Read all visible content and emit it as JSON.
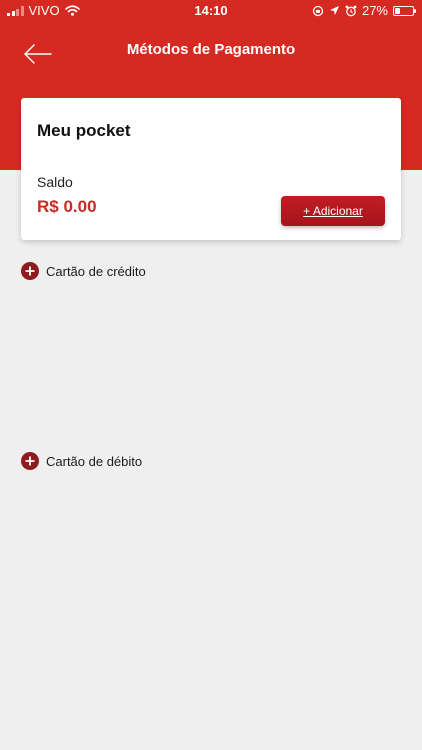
{
  "status_bar": {
    "carrier": "VIVO",
    "time": "14:10",
    "battery_text": "27%",
    "battery_level": 0.27,
    "icons": [
      "signal-icon",
      "wifi-icon",
      "rotation-lock-icon",
      "location-icon",
      "alarm-icon",
      "battery-icon"
    ]
  },
  "header": {
    "title": "Métodos de Pagamento",
    "back_icon": "arrow-left-icon"
  },
  "pocket": {
    "title": "Meu pocket",
    "balance_label": "Saldo",
    "balance_value": "R$ 0.00",
    "add_button_label": "+ Adicionar"
  },
  "methods": [
    {
      "label": "Cartão de crédito",
      "icon": "plus-circle-icon"
    },
    {
      "label": "Cartão de débito",
      "icon": "plus-circle-icon"
    }
  ],
  "colors": {
    "header": "#d52a22",
    "button": "#b3161d",
    "balance": "#c62d26",
    "plus_icon": "#8e1c1f",
    "background": "#efefef"
  }
}
